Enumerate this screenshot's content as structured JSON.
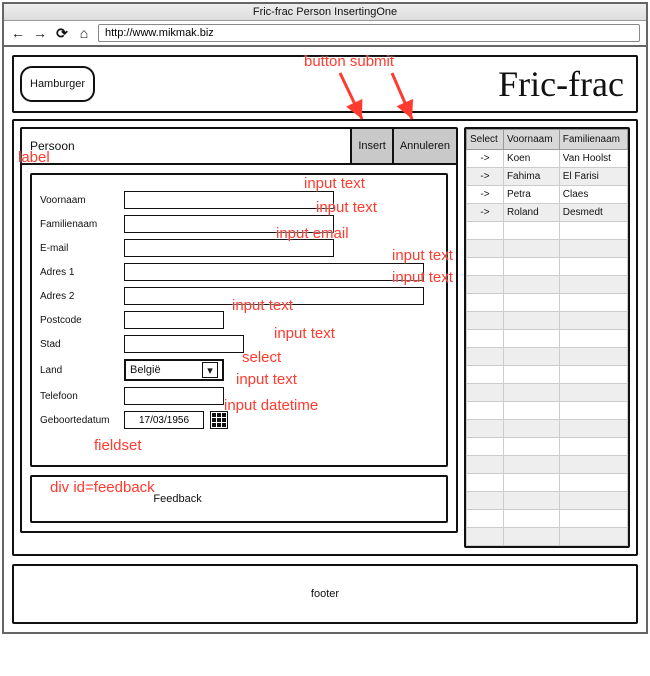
{
  "window": {
    "title": "Fric-frac Person InsertingOne"
  },
  "url": "http://www.mikmak.biz",
  "header": {
    "hamburger": "Hamburger",
    "brand": "Fric-frac"
  },
  "panel": {
    "title": "Persoon",
    "insert": "Insert",
    "cancel": "Annuleren"
  },
  "form": {
    "voornaam_label": "Voornaam",
    "familienaam_label": "Familienaam",
    "email_label": "E-mail",
    "adres1_label": "Adres 1",
    "adres2_label": "Adres 2",
    "postcode_label": "Postcode",
    "stad_label": "Stad",
    "land_label": "Land",
    "land_value": "België",
    "telefoon_label": "Telefoon",
    "geboorte_label": "Geboortedatum",
    "geboorte_value": "17/03/1956"
  },
  "feedback": {
    "text": "Feedback"
  },
  "table": {
    "headers": {
      "select": "Select",
      "voornaam": "Voornaam",
      "familienaam": "Familienaam"
    },
    "rows": [
      {
        "sel": "->",
        "v": "Koen",
        "f": "Van Hoolst"
      },
      {
        "sel": "->",
        "v": "Fahima",
        "f": "El Farisi"
      },
      {
        "sel": "->",
        "v": "Petra",
        "f": "Claes"
      },
      {
        "sel": "->",
        "v": "Roland",
        "f": "Desmedt"
      }
    ]
  },
  "footer": "footer",
  "annotations": {
    "button_submit": "button submit",
    "label": "label",
    "input_text": "input text",
    "input_email": "input email",
    "select": "select",
    "input_datetime": "input datetime",
    "fieldset": "fieldset",
    "feedback": "div id=feedback"
  }
}
